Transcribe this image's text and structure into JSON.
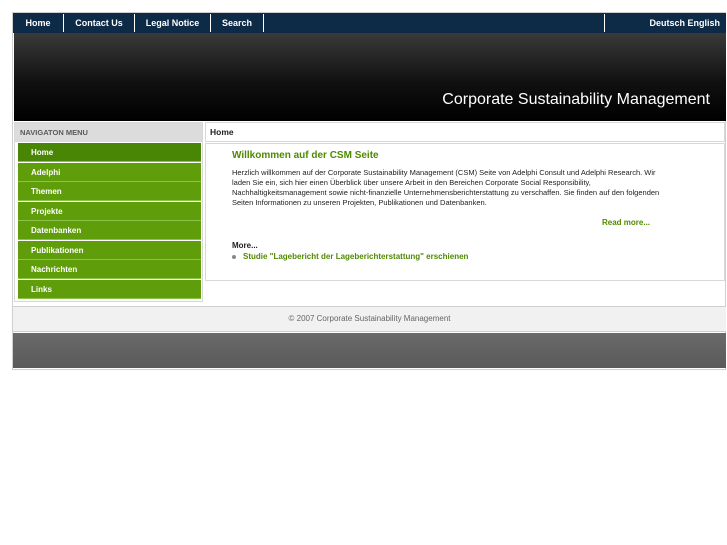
{
  "topnav": {
    "items": [
      "Home",
      "Contact Us",
      "Legal Notice",
      "Search"
    ],
    "language": "Deutsch English"
  },
  "header": {
    "title": "Corporate Sustainability Management"
  },
  "sidebar": {
    "heading": "NAVIGATON MENU",
    "items": [
      "Home",
      "Adelphi",
      "Themen",
      "Projekte",
      "Datenbanken",
      "Publikationen",
      "Nachrichten",
      "Links"
    ]
  },
  "main": {
    "breadcrumb": "Home",
    "welcome_title": "Willkommen auf der CSM Seite",
    "intro": "Herzlich willkommen auf der Corporate Sustainability Management (CSM) Seite von Adelphi Consult und Adelphi Research. Wir laden Sie ein, sich hier einen Überblick über unsere Arbeit in den Bereichen Corporate Social Responsibility, Nachhaltigkeitsmanagement sowie nicht-finanzielle Unternehmensberichterstattung zu verschaffen. Sie finden auf den folgenden Seiten Informationen zu unseren Projekten, Publikationen und Datenbanken.",
    "read_more": "Read more...",
    "more_label": "More...",
    "news_link": "Studie \"Lagebericht der Lageberichterstattung\" erschienen"
  },
  "footer": {
    "copyright": "© 2007 Corporate Sustainability Management"
  },
  "colors": {
    "nav_bg": "#0d2a47",
    "accent_green": "#5f9e0a",
    "link_green": "#4f8a00"
  }
}
